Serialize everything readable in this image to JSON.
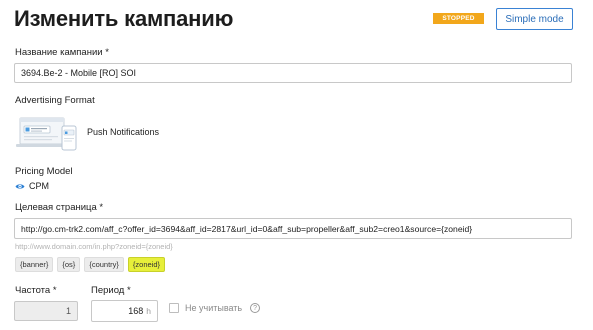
{
  "header": {
    "title": "Изменить кампанию",
    "status": "STOPPED",
    "mode_button": "Simple mode"
  },
  "campaign_name": {
    "label": "Название кампании",
    "required_mark": "*",
    "value": "3694.Be-2 - Mobile [RO] SOI"
  },
  "advertising_format": {
    "label": "Advertising Format",
    "value": "Push Notifications",
    "icon": "push-notification-illustration"
  },
  "pricing_model": {
    "label": "Pricing Model",
    "value": "CPM",
    "icon": "eye-icon"
  },
  "target_url": {
    "label": "Целевая страница",
    "required_mark": "*",
    "value": "http://go.cm-trk2.com/aff_c?offer_id=3694&aff_id=2817&url_id=0&aff_sub=propeller&aff_sub2=creo1&source={zoneid}",
    "hint": "http://www.domain.com/in.php?zoneid={zoneid}",
    "macros": [
      "{banner}",
      "{os}",
      "{country}",
      "{zoneid}"
    ],
    "active_macro": "{zoneid}"
  },
  "frequency": {
    "label": "Частота",
    "required_mark": "*",
    "value": "1"
  },
  "period": {
    "label": "Период",
    "required_mark": "*",
    "value": "168",
    "unit": "h"
  },
  "ignore_checkbox": {
    "label": "Не учитывать",
    "checked": false
  },
  "colors": {
    "status_badge": "#f2a71b",
    "accent": "#3a82d4",
    "active_macro": "#e7ef3a"
  }
}
